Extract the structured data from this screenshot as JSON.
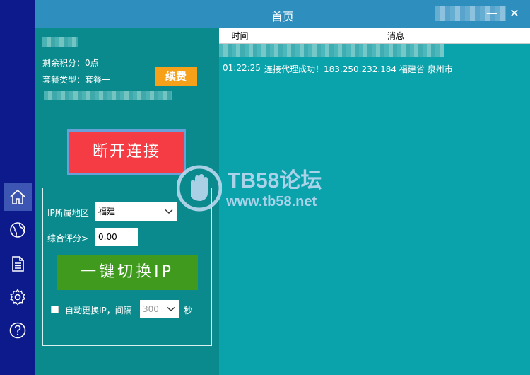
{
  "window": {
    "title": "首页",
    "minimize_glyph": "—",
    "close_glyph": "✕"
  },
  "nav": {
    "items": [
      {
        "icon": "home-icon",
        "active": true
      },
      {
        "icon": "globe-icon",
        "active": false
      },
      {
        "icon": "document-icon",
        "active": false
      },
      {
        "icon": "gear-icon",
        "active": false
      },
      {
        "icon": "help-icon",
        "active": false
      }
    ]
  },
  "account": {
    "points_label": "剩余积分：0点",
    "package_label": "套餐类型：套餐一",
    "renew_button": "续费"
  },
  "connection": {
    "disconnect_button": "断开连接"
  },
  "settings": {
    "region_label": "IP所属地区",
    "region_value": "福建",
    "score_label": "综合评分>",
    "score_value": "0.00",
    "switch_button": "一键切换IP",
    "auto_switch_label": "自动更换IP，间隔",
    "interval_value": "300",
    "interval_unit": "秒"
  },
  "log": {
    "columns": {
      "time": "时间",
      "message": "消息"
    },
    "rows": [
      {
        "time": "01:22:25",
        "message": "连接代理成功！183.250.232.184 福建省 泉州市"
      }
    ]
  },
  "watermark": {
    "line1": "TB58论坛",
    "line2": "www.tb58.net"
  },
  "colors": {
    "nav_bg": "#0c1a8c",
    "titlebar_bg": "#2e8fbf",
    "left_panel_bg": "#0a8a8c",
    "log_bg": "#0aa2ab",
    "renew": "#f7a01a",
    "disconnect": "#f53c45",
    "switch": "#3f9a1e"
  }
}
